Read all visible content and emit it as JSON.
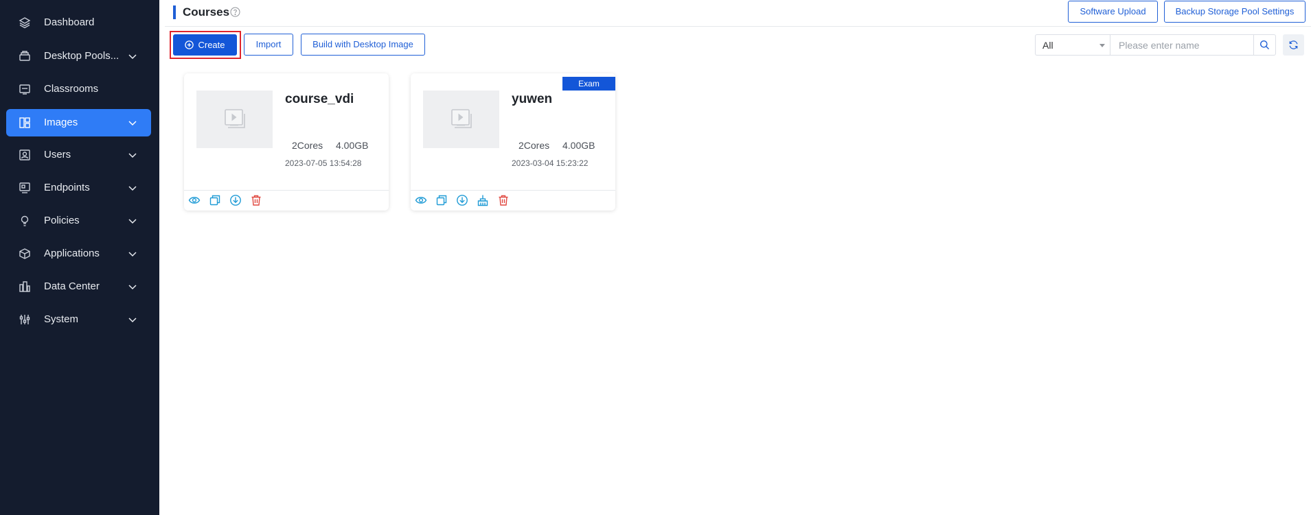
{
  "sidebar": {
    "items": [
      {
        "label": "Dashboard",
        "icon": "layers-icon"
      },
      {
        "label": "Desktop Pools...",
        "icon": "stack-icon"
      },
      {
        "label": "Classrooms",
        "icon": "classroom-icon"
      },
      {
        "label": "Images",
        "icon": "images-icon"
      },
      {
        "label": "Users",
        "icon": "user-icon"
      },
      {
        "label": "Endpoints",
        "icon": "endpoint-icon"
      },
      {
        "label": "Policies",
        "icon": "lightbulb-icon"
      },
      {
        "label": "Applications",
        "icon": "package-icon"
      },
      {
        "label": "Data Center",
        "icon": "building-icon"
      },
      {
        "label": "System",
        "icon": "sliders-icon"
      }
    ],
    "active": "Images",
    "colors": {
      "background": "#141c2e",
      "active": "#2f7cf6",
      "text": "#e8ebf0"
    }
  },
  "header": {
    "title": "Courses",
    "software_upload_label": "Software Upload",
    "backup_storage_label": "Backup Storage Pool Settings"
  },
  "toolbar": {
    "create_label": "Create",
    "import_label": "Import",
    "build_label": "Build with Desktop Image"
  },
  "search": {
    "filter_value": "All",
    "placeholder": "Please enter name"
  },
  "cards": [
    {
      "name": "course_vdi",
      "cores": "2Cores",
      "memory": "4.00GB",
      "date": "2023-07-05 13:54:28",
      "badge": "",
      "actions": [
        "view-icon",
        "copy-icon",
        "download-icon",
        "delete-icon"
      ]
    },
    {
      "name": "yuwen",
      "cores": "2Cores",
      "memory": "4.00GB",
      "date": "2023-03-04 15:23:22",
      "badge": "Exam",
      "actions": [
        "view-icon",
        "copy-icon",
        "download-icon",
        "clean-icon",
        "delete-icon"
      ]
    }
  ],
  "colors": {
    "primary": "#1356d8",
    "accent_icon": "#1f9bd6",
    "danger_icon": "#e0473f",
    "highlight_border": "#e0242c"
  }
}
